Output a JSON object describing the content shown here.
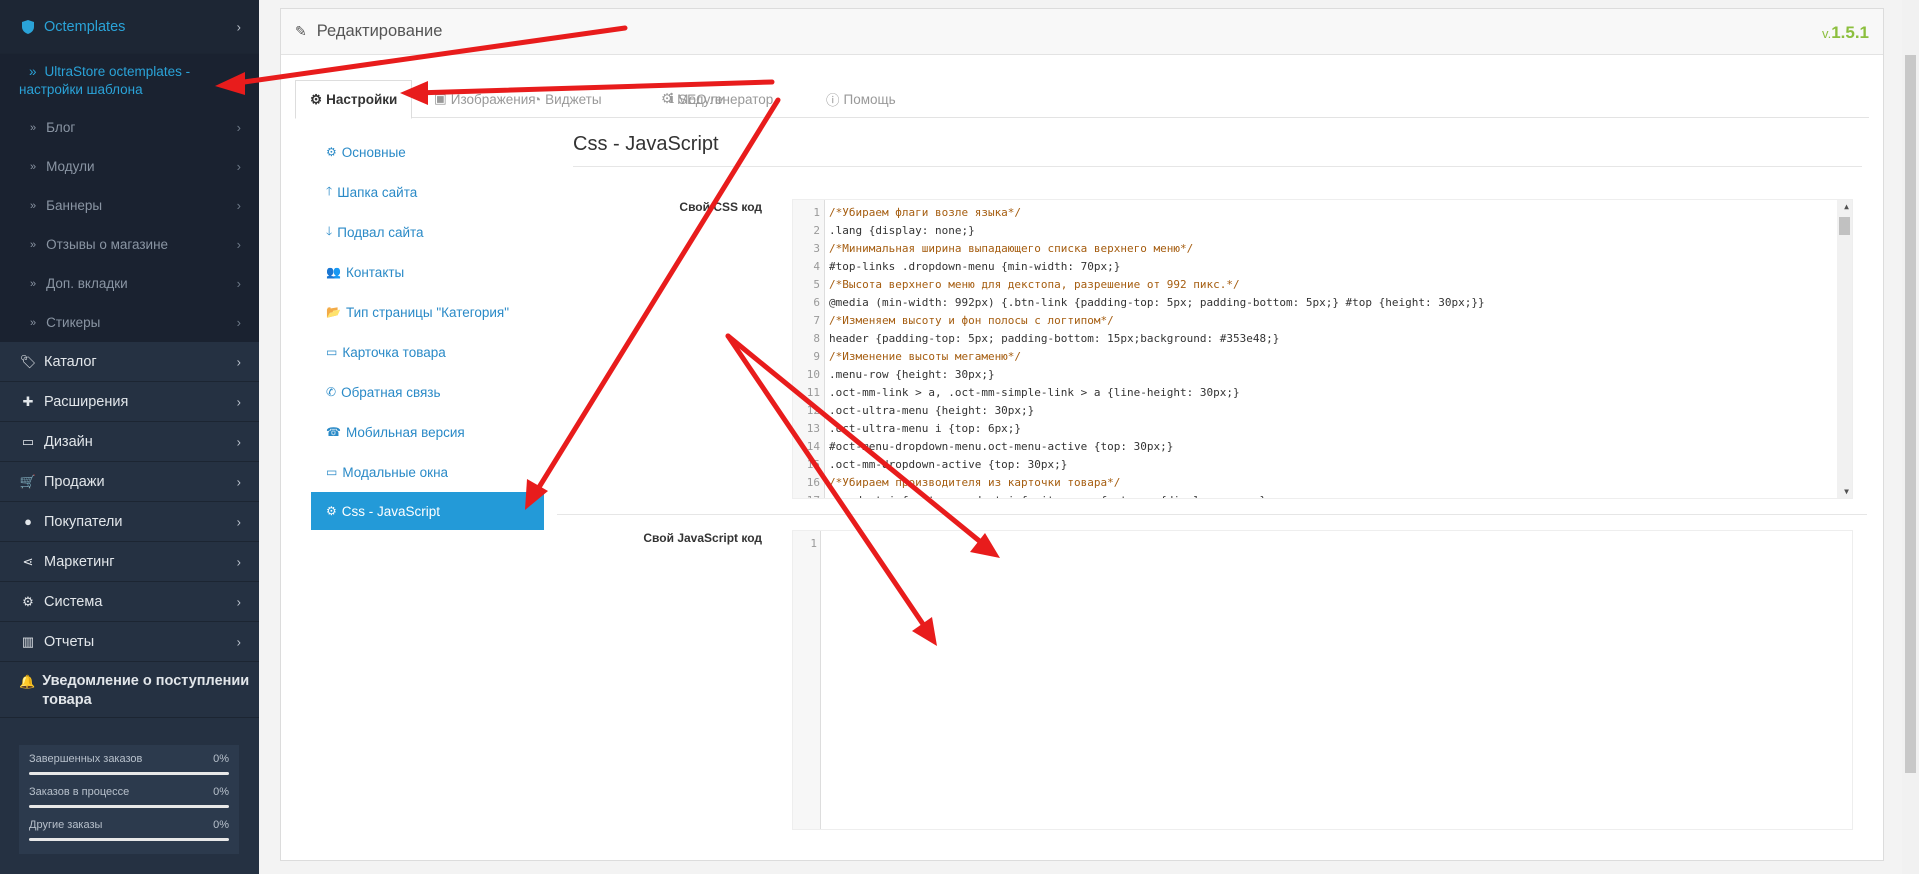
{
  "sidebar": {
    "top": {
      "icon": "shield-icon",
      "label": "Octemplates"
    },
    "active_sub": "UltraStore octemplates - настройки шаблона",
    "children": [
      "Блог",
      "Модули",
      "Баннеры",
      "Отзывы о магазине",
      "Доп. вкладки",
      "Стикеры"
    ],
    "items": [
      {
        "icon": "tags-icon",
        "label": "Каталог"
      },
      {
        "icon": "puzzle-icon",
        "label": "Расширения"
      },
      {
        "icon": "monitor-icon",
        "label": "Дизайн"
      },
      {
        "icon": "cart-icon",
        "label": "Продажи"
      },
      {
        "icon": "user-icon",
        "label": "Покупатели"
      },
      {
        "icon": "share-icon",
        "label": "Маркетинг"
      },
      {
        "icon": "gear-icon",
        "label": "Система"
      },
      {
        "icon": "bar-chart-icon",
        "label": "Отчеты"
      },
      {
        "icon": "bell-icon",
        "label": "Уведомление о поступлении товара"
      }
    ],
    "stats": [
      {
        "label": "Завершенных заказов",
        "value": "0%"
      },
      {
        "label": "Заказов в процессе",
        "value": "0%"
      },
      {
        "label": "Другие заказы",
        "value": "0%"
      }
    ]
  },
  "panel": {
    "title": "Редактирование",
    "version_prefix": "v.",
    "version": "1.5.1"
  },
  "tabs": [
    {
      "icon": "gear-icon",
      "label": "Настройки",
      "active": true
    },
    {
      "icon": "image-icon",
      "label": "Изображения"
    },
    {
      "icon": "widget-icon",
      "label": "Виджеты"
    },
    {
      "icon": "gear-icon",
      "label": "Модули"
    },
    {
      "icon": "info-icon",
      "label": "SEO генератор"
    },
    {
      "icon": "info-circle-icon",
      "label": "Помощь"
    }
  ],
  "nav": [
    {
      "icon": "gear-icon",
      "label": "Основные"
    },
    {
      "icon": "arrow-up-icon",
      "label": "Шапка сайта"
    },
    {
      "icon": "arrow-down-icon",
      "label": "Подвал сайта"
    },
    {
      "icon": "users-icon",
      "label": "Контакты"
    },
    {
      "icon": "folder-open-icon",
      "label": "Тип страницы \"Категория\""
    },
    {
      "icon": "desktop-icon",
      "label": "Карточка товара"
    },
    {
      "icon": "phone-icon",
      "label": "Обратная связь"
    },
    {
      "icon": "phone-square-icon",
      "label": "Мобильная версия"
    },
    {
      "icon": "window-icon",
      "label": "Модальные окна"
    },
    {
      "icon": "gear-icon",
      "label": "Css - JavaScript",
      "active": true
    }
  ],
  "content": {
    "heading": "Css - JavaScript",
    "css_label": "Свой CSS код",
    "js_label": "Свой JavaScript код",
    "css_lines": [
      "/*Убираем флаги возле языка*/",
      ".lang {display: none;}",
      "/*Минимальная ширина выпадающего списка верхнего меню*/",
      "#top-links .dropdown-menu {min-width: 70px;}",
      "/*Высота верхнего меню для декстопа, разрешение от 992 пикс.*/",
      "@media (min-width: 992px) {.btn-link {padding-top: 5px; padding-bottom: 5px;} #top {height: 30px;}}",
      "/*Изменяем высоту и фон полосы с логтипом*/",
      "header {padding-top: 5px; padding-bottom: 15px;background: #353e48;}",
      "/*Изменение высоты мегаменю*/",
      ".menu-row {height: 30px;}",
      ".oct-mm-link > a, .oct-mm-simple-link > a {line-height: 30px;}",
      ".oct-ultra-menu {height: 30px;}",
      ".oct-ultra-menu i {top: 6px;}",
      "#oct-menu-dropdown-menu.oct-menu-active {top: 30px;}",
      ".oct-mm-dropdown-active {top: 30px;}",
      "/*Убираем производителя из карточки товара*/",
      ".product-info-item.product-info-item-manufacturer {display: none;}"
    ],
    "js_lines": [
      "1"
    ]
  },
  "colors": {
    "sidebar_bg": "#253142",
    "accent": "#239ad8",
    "annotation": "#e81c1c",
    "version": "#8cbf3e"
  }
}
